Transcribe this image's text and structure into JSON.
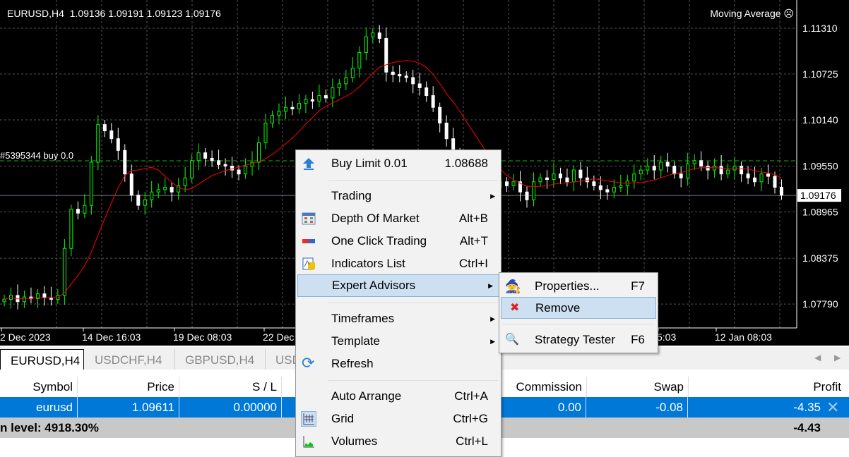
{
  "chart": {
    "symbol_header": "EURUSD,H4  1.09136 1.09191 1.09123 1.09176",
    "expert_label": "Moving Average ☹",
    "order_line_label": "#5395344 buy 0.0",
    "price_axis": [
      "1.11310",
      "1.10725",
      "1.10140",
      "1.09550",
      "1.08965",
      "1.08375",
      "1.07790"
    ],
    "current_price": "1.09176",
    "time_axis": [
      "2 Dec 2023",
      "14 Dec 16:03",
      "19 Dec 08:03",
      "22 Dec",
      "5:03",
      "12 Jan 08:03"
    ],
    "colors": {
      "bull": "#00ff00",
      "bear": "#ffffff",
      "ma": "#ff0000",
      "order_line": "#00c000"
    },
    "closes": [
      1.0785,
      1.079,
      1.0782,
      1.0788,
      1.0786,
      1.0792,
      1.0787,
      1.0785,
      1.079,
      1.085,
      1.09,
      1.0895,
      1.0905,
      1.096,
      1.1008,
      1.1,
      1.099,
      1.0975,
      1.0945,
      1.0918,
      1.0905,
      1.0912,
      1.0922,
      1.0925,
      1.0928,
      1.0922,
      1.093,
      1.094,
      1.0962,
      1.0972,
      1.0965,
      1.0962,
      1.0957,
      1.0955,
      1.095,
      1.0945,
      1.0955,
      1.096,
      1.0985,
      1.101,
      1.102,
      1.1025,
      1.103,
      1.1028,
      1.1035,
      1.104,
      1.1038,
      1.1045,
      1.1042,
      1.1055,
      1.106,
      1.1068,
      1.108,
      1.11,
      1.112,
      1.1125,
      1.1118,
      1.1075,
      1.1072,
      1.107,
      1.1068,
      1.106,
      1.1055,
      1.1045,
      1.103,
      1.101,
      1.099,
      1.097,
      1.095,
      1.0935,
      1.094,
      1.093,
      1.0925,
      1.0928,
      1.0935,
      1.093,
      1.0935,
      1.0922,
      1.0912,
      1.0935,
      1.094,
      1.0938,
      1.0945,
      1.094,
      1.0935,
      1.095,
      1.094,
      1.0935,
      1.093,
      1.0925,
      1.0922,
      1.0928,
      1.093,
      1.0936,
      1.0945,
      1.095,
      1.0955,
      1.095,
      1.096,
      1.0955,
      1.0945,
      1.094,
      1.0958,
      1.0962,
      1.0955,
      1.095,
      1.0955,
      1.0945,
      1.095,
      1.0955,
      1.0945,
      1.094,
      1.0935,
      1.0945,
      1.0942,
      1.0928,
      1.0918
    ]
  },
  "tabs": [
    "EURUSD,H4",
    "USDCHF,H4",
    "GBPUSD,H4",
    "USD"
  ],
  "table": {
    "headers": {
      "symbol": "Symbol",
      "price": "Price",
      "sl": "S / L",
      "commission": "Commission",
      "swap": "Swap",
      "profit": "Profit"
    },
    "row": {
      "symbol": "eurusd",
      "price": "1.09611",
      "sl": "0.00000",
      "commission": "0.00",
      "swap": "-0.08",
      "profit": "-4.35"
    },
    "summary": {
      "level": "n level: 4918.30%",
      "profit": "-4.43"
    }
  },
  "menu": {
    "buy_limit": {
      "label": "Buy Limit 0.01",
      "value": "1.08688"
    },
    "items": [
      {
        "label": "Trading",
        "shortcut": ""
      },
      {
        "label": "Depth Of Market",
        "shortcut": "Alt+B"
      },
      {
        "label": "One Click Trading",
        "shortcut": "Alt+T"
      },
      {
        "label": "Indicators List",
        "shortcut": "Ctrl+I"
      },
      {
        "label": "Expert Advisors",
        "shortcut": ""
      },
      {
        "label": "Timeframes",
        "shortcut": ""
      },
      {
        "label": "Template",
        "shortcut": ""
      },
      {
        "label": "Refresh",
        "shortcut": ""
      },
      {
        "label": "Auto Arrange",
        "shortcut": "Ctrl+A"
      },
      {
        "label": "Grid",
        "shortcut": "Ctrl+G"
      },
      {
        "label": "Volumes",
        "shortcut": "Ctrl+L"
      }
    ]
  },
  "submenu": [
    {
      "label": "Properties...",
      "shortcut": "F7"
    },
    {
      "label": "Remove",
      "shortcut": ""
    },
    {
      "label": "Strategy Tester",
      "shortcut": "F6"
    }
  ]
}
